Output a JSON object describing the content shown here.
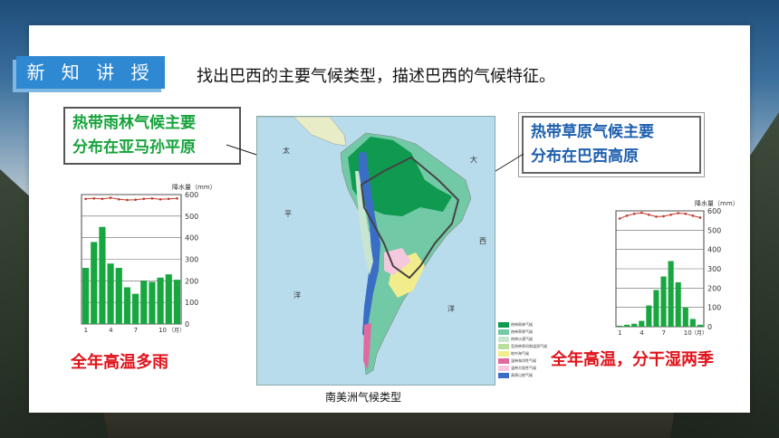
{
  "tab_label": "新 知 讲 授",
  "heading": "找出巴西的主要气候类型，描述巴西的气候特征。",
  "callout_rainforest": [
    "热带雨林气候主要",
    "分布在亚马孙平原"
  ],
  "callout_savanna": [
    "热带草原气候主要",
    "分布在巴西高原"
  ],
  "conclusion_left": "全年高温多雨",
  "conclusion_right": "全年高温，分干湿两季",
  "map_caption": "南美洲气候类型",
  "map": {
    "ocean_labels": [
      "太",
      "平",
      "洋",
      "大",
      "西",
      "洋"
    ],
    "legend": [
      {
        "color": "#0f9a50",
        "label": "热带雨林气候"
      },
      {
        "color": "#72c9a6",
        "label": "热带草原气候"
      },
      {
        "color": "#c6e6d0",
        "label": "热带沙漠气候"
      },
      {
        "color": "#b8e09a",
        "label": "亚热带季风和湿润气候"
      },
      {
        "color": "#f2ed8c",
        "label": "地中海气候"
      },
      {
        "color": "#e06aa0",
        "label": "温带海洋性气候"
      },
      {
        "color": "#f5c8dd",
        "label": "温带大陆性气候"
      },
      {
        "color": "#3a6dc4",
        "label": "高原山地气候"
      }
    ]
  },
  "colors": {
    "tab": "#2e88d2",
    "green_text": "#16a33b",
    "blue_text": "#1d5fae",
    "red_text": "#e0131b",
    "bar": "#17a63f",
    "temp_line": "#c0392b"
  },
  "chart_data": [
    {
      "type": "bar",
      "title": "",
      "ylabel": "降水量（mm）",
      "xlabel": "（月）",
      "x_ticks": [
        "1",
        "4",
        "7",
        "10"
      ],
      "y_ticks": [
        0,
        100,
        200,
        300,
        400,
        500,
        600
      ],
      "ylim": [
        0,
        600
      ],
      "categories": [
        "1",
        "2",
        "3",
        "4",
        "5",
        "6",
        "7",
        "8",
        "9",
        "10",
        "11",
        "12"
      ],
      "series": [
        {
          "name": "降水量",
          "values": [
            260,
            380,
            450,
            280,
            260,
            170,
            140,
            200,
            195,
            215,
            230,
            205
          ]
        }
      ],
      "temperature_line": [
        580,
        582,
        580,
        585,
        578,
        575,
        576,
        580,
        582,
        578,
        580,
        582
      ]
    },
    {
      "type": "bar",
      "title": "",
      "ylabel": "降水量（mm）",
      "xlabel": "（月）",
      "x_ticks": [
        "1",
        "4",
        "7",
        "10"
      ],
      "y_ticks": [
        0,
        100,
        200,
        300,
        400,
        500,
        600
      ],
      "ylim": [
        0,
        600
      ],
      "categories": [
        "1",
        "2",
        "3",
        "4",
        "5",
        "6",
        "7",
        "8",
        "9",
        "10",
        "11",
        "12"
      ],
      "series": [
        {
          "name": "降水量",
          "values": [
            5,
            10,
            15,
            30,
            110,
            190,
            260,
            340,
            230,
            100,
            40,
            10
          ]
        }
      ],
      "temperature_line": [
        560,
        575,
        585,
        590,
        580,
        570,
        572,
        580,
        588,
        585,
        575,
        565
      ]
    }
  ]
}
